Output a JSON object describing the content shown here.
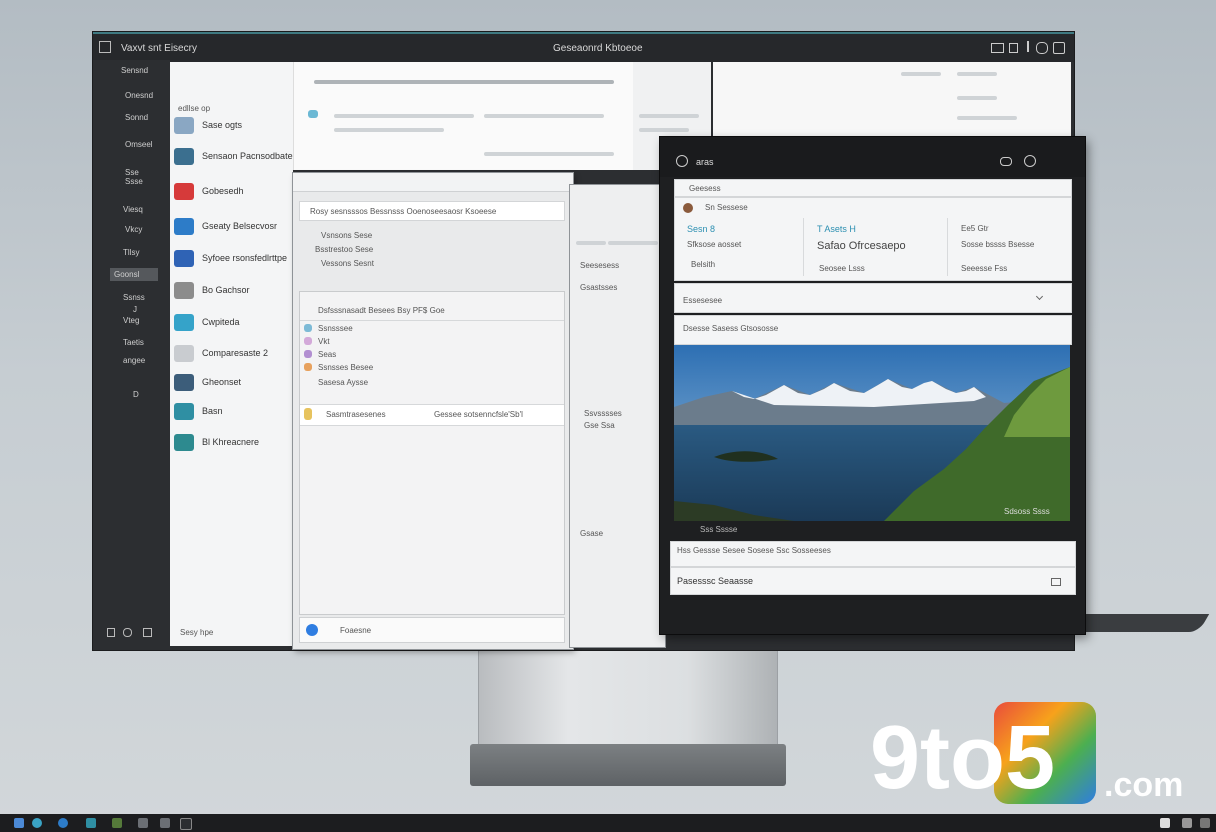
{
  "main_window": {
    "title_left": "Vaxvt snt Eisecry",
    "title_center": "Geseaonrd Kbtoeoe"
  },
  "sidebar": {
    "header": "Sensnd",
    "items": [
      "Onesnd",
      "Sonnd",
      "Omseel",
      "Sse",
      "Ssse",
      "Viesq",
      "Vkcy",
      "Tllsy",
      "Goonsl",
      "Ssnss",
      "J",
      "Vteg",
      "Taetis",
      "angee",
      "D"
    ]
  },
  "apps_panel": {
    "header": "edllse op",
    "items": [
      {
        "label": "Sase ogts",
        "color": "#8aa7c3"
      },
      {
        "label": "Sensaon Pacnsodbatep",
        "color": "#3b6f8f"
      },
      {
        "label": "Gobesedh",
        "color": "#d63a3a"
      },
      {
        "label": "Gseaty Belsecvosr",
        "color": "#2d7cc8"
      },
      {
        "label": "Syfoee rsonsfedlrttpe",
        "color": "#2f63b5"
      },
      {
        "label": "Bo Gachsor",
        "color": "#8c8c8c"
      },
      {
        "label": "Cwpiteda",
        "color": "#35a3c9"
      },
      {
        "label": "Comparesaste 2",
        "color": "#c9ccd0"
      },
      {
        "label": "Gheonset",
        "color": "#3c5d7a"
      },
      {
        "label": "Basn",
        "color": "#2f8fa3"
      },
      {
        "label": "Bl Khreacnere",
        "color": "#2d8a8f"
      }
    ],
    "footer": "Sesy hpe"
  },
  "win_a": {
    "header": "Rosy sesnsssos Bessnsss Ooenoseesaosr Ksoeese",
    "rows": [
      "Vsnsons Sese",
      "Bsstrestoo Sese",
      "Vessons Sesnt"
    ],
    "section_header": "Dsfsssnasadt Besees Bsy PF$ Goe",
    "items": [
      "Ssnsssee",
      "Vkt",
      "Seas",
      "Ssnsses Besee",
      "Sasesa Aysse"
    ],
    "row_a": "Sasmtrasesenes",
    "row_b": "Gessee sotsenncfsle'Sb'l",
    "footer": "Foaesne"
  },
  "win_b": {
    "rows": [
      "Seesesess",
      "Gsastsses",
      "Ssvsssses",
      "Gse Ssa"
    ],
    "footer": "Gsase"
  },
  "photo_window": {
    "title": "aras",
    "breadcrumb": "Geesess",
    "profile_name": "Sn Sessese",
    "stats": [
      {
        "head": "Sesn 8",
        "sub": "Sfksose aosset",
        "foot": "Belsith"
      },
      {
        "head": "T Asets H",
        "sub": "Safao Ofrcesaepo",
        "foot": "Seosee Lsss"
      },
      {
        "head": "Ee5 Gtr",
        "sub": "Sosse bssss Bsesse",
        "foot": "Seeesse Fss"
      }
    ],
    "filter_label": "Essesesee",
    "section_label": "Dsesse Sasess Gtsososse",
    "caption_right": "Sdsoss  Ssss",
    "caption_left": "Sss  Sssse",
    "bottom_row": "Hss Gessse Sesee Sosese Ssc Sosseeses",
    "search_label": "Pasesssc Seaasse"
  },
  "watermark": {
    "brand": "9to5",
    "suffix": ".com",
    "colors": [
      "#e94b3c",
      "#f7a21b",
      "#4caf50",
      "#2f7de1"
    ]
  },
  "colors": {
    "title_accent": "#3f7a82",
    "dark_chrome": "#2c2e31",
    "panel": "#f4f5f6"
  }
}
